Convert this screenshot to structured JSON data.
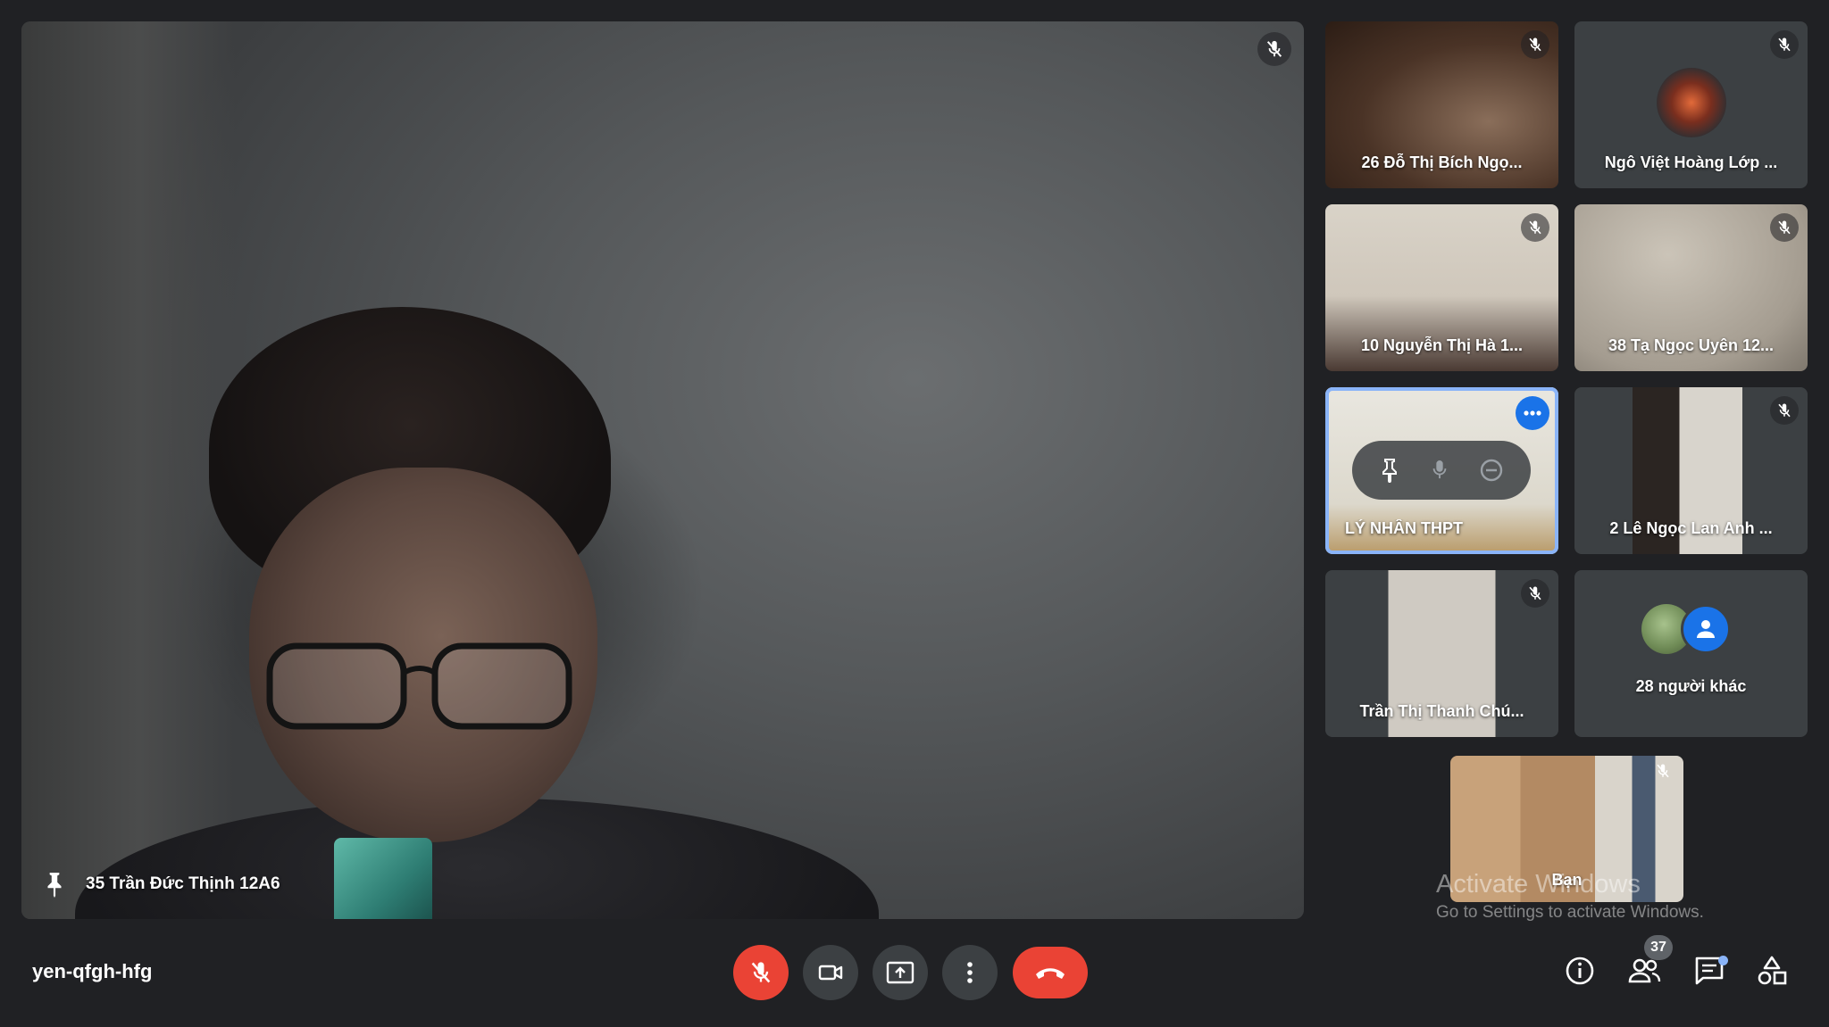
{
  "meeting": {
    "code": "yen-qfgh-hfg"
  },
  "main_speaker": {
    "name": "35 Trần Đức Thịnh 12A6"
  },
  "participants": [
    {
      "name": "26 Đỗ Thị Bích Ngọ..."
    },
    {
      "name": "Ngô Việt Hoàng Lớp ..."
    },
    {
      "name": "10 Nguyễn Thị Hà 1..."
    },
    {
      "name": "38 Tạ Ngọc Uyên 12..."
    },
    {
      "name": "LÝ NHÂN THPT"
    },
    {
      "name": "2 Lê Ngọc Lan Anh ..."
    },
    {
      "name": "Trần Thị Thanh Chú..."
    },
    {
      "name": "28 người khác"
    }
  ],
  "self_view": {
    "label": "Bạn"
  },
  "participant_count": "37",
  "watermark": {
    "title": "Activate Windows",
    "subtitle": "Go to Settings to activate Windows."
  },
  "colors": {
    "background": "#202124",
    "tile": "#3c4043",
    "danger": "#ea4335",
    "accent": "#1a73e8",
    "focus": "#8ab4f8"
  },
  "icons": {
    "mic_off": "mic-off-icon",
    "camera": "videocam-icon",
    "present": "present-screen-icon",
    "more": "more-vert-icon",
    "hangup": "call-end-icon",
    "info": "info-icon",
    "people": "people-icon",
    "chat": "chat-icon",
    "activities": "activities-icon",
    "pin": "pin-icon"
  }
}
